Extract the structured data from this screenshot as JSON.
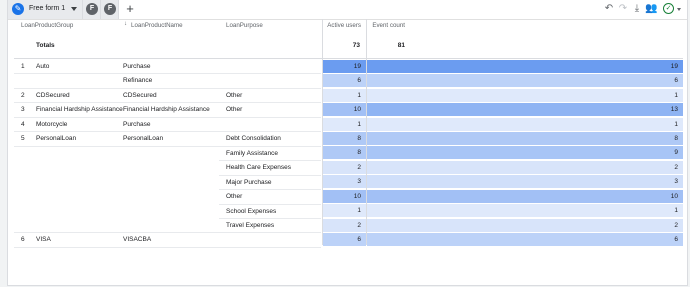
{
  "toolbar": {
    "tab_label": "Free form 1",
    "tab_icon": "pencil-icon",
    "extra_tabs": [
      "F",
      "F"
    ],
    "add_label": "+",
    "icons": [
      "undo-icon",
      "redo-icon",
      "download-icon",
      "share-icon",
      "check-circle-icon"
    ]
  },
  "table": {
    "headers": {
      "group": "LoanProductGroup",
      "name": "LoanProductName",
      "purpose": "LoanPurpose",
      "active": "Active users",
      "events": "Event count"
    },
    "totals": {
      "label": "Totals",
      "active": "73",
      "events": "81"
    },
    "rows": [
      {
        "idx": "1",
        "group": "Auto",
        "name": "Purchase",
        "purpose": "",
        "active": "19",
        "events": "19"
      },
      {
        "idx": "",
        "group": "",
        "name": "Refinance",
        "purpose": "",
        "active": "6",
        "events": "6"
      },
      {
        "idx": "2",
        "group": "CDSecured",
        "name": "CDSecured",
        "purpose": "Other",
        "active": "1",
        "events": "1"
      },
      {
        "idx": "3",
        "group": "Financial Hardship Assistance",
        "name": "Financial Hardship Assistance",
        "purpose": "Other",
        "active": "10",
        "events": "13"
      },
      {
        "idx": "4",
        "group": "Motorcycle",
        "name": "Purchase",
        "purpose": "",
        "active": "1",
        "events": "1"
      },
      {
        "idx": "5",
        "group": "PersonalLoan",
        "name": "PersonalLoan",
        "purpose": "Debt Consolidation",
        "active": "8",
        "events": "8"
      },
      {
        "idx": "",
        "group": "",
        "name": "",
        "purpose": "Family Assistance",
        "active": "8",
        "events": "9"
      },
      {
        "idx": "",
        "group": "",
        "name": "",
        "purpose": "Health Care Expenses",
        "active": "2",
        "events": "2"
      },
      {
        "idx": "",
        "group": "",
        "name": "",
        "purpose": "Major Purchase",
        "active": "3",
        "events": "3"
      },
      {
        "idx": "",
        "group": "",
        "name": "",
        "purpose": "Other",
        "active": "10",
        "events": "10"
      },
      {
        "idx": "",
        "group": "",
        "name": "",
        "purpose": "School Expenses",
        "active": "1",
        "events": "1"
      },
      {
        "idx": "",
        "group": "",
        "name": "",
        "purpose": "Travel Expenses",
        "active": "2",
        "events": "2"
      },
      {
        "idx": "6",
        "group": "VISA",
        "name": "VISACBA",
        "purpose": "",
        "active": "6",
        "events": "6"
      }
    ]
  },
  "colors": {
    "heat_low": "#e8effc",
    "heat_high": "#6b9cf0"
  }
}
